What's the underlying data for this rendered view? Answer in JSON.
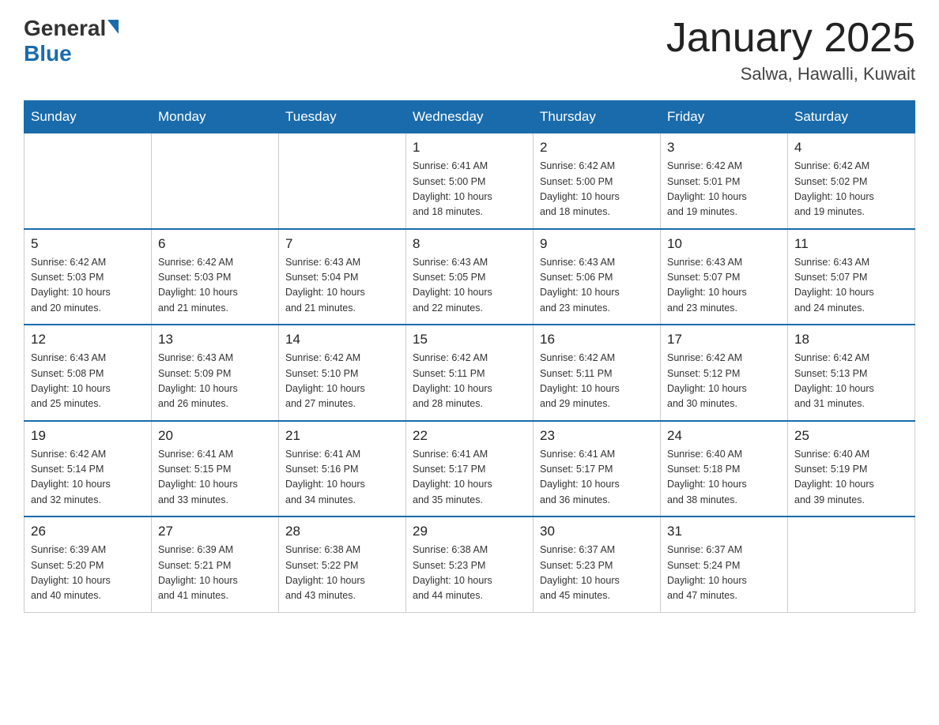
{
  "header": {
    "logo_general": "General",
    "logo_blue": "Blue",
    "title": "January 2025",
    "location": "Salwa, Hawalli, Kuwait"
  },
  "days_of_week": [
    "Sunday",
    "Monday",
    "Tuesday",
    "Wednesday",
    "Thursday",
    "Friday",
    "Saturday"
  ],
  "weeks": [
    {
      "days": [
        {
          "num": "",
          "info": ""
        },
        {
          "num": "",
          "info": ""
        },
        {
          "num": "",
          "info": ""
        },
        {
          "num": "1",
          "info": "Sunrise: 6:41 AM\nSunset: 5:00 PM\nDaylight: 10 hours\nand 18 minutes."
        },
        {
          "num": "2",
          "info": "Sunrise: 6:42 AM\nSunset: 5:00 PM\nDaylight: 10 hours\nand 18 minutes."
        },
        {
          "num": "3",
          "info": "Sunrise: 6:42 AM\nSunset: 5:01 PM\nDaylight: 10 hours\nand 19 minutes."
        },
        {
          "num": "4",
          "info": "Sunrise: 6:42 AM\nSunset: 5:02 PM\nDaylight: 10 hours\nand 19 minutes."
        }
      ]
    },
    {
      "days": [
        {
          "num": "5",
          "info": "Sunrise: 6:42 AM\nSunset: 5:03 PM\nDaylight: 10 hours\nand 20 minutes."
        },
        {
          "num": "6",
          "info": "Sunrise: 6:42 AM\nSunset: 5:03 PM\nDaylight: 10 hours\nand 21 minutes."
        },
        {
          "num": "7",
          "info": "Sunrise: 6:43 AM\nSunset: 5:04 PM\nDaylight: 10 hours\nand 21 minutes."
        },
        {
          "num": "8",
          "info": "Sunrise: 6:43 AM\nSunset: 5:05 PM\nDaylight: 10 hours\nand 22 minutes."
        },
        {
          "num": "9",
          "info": "Sunrise: 6:43 AM\nSunset: 5:06 PM\nDaylight: 10 hours\nand 23 minutes."
        },
        {
          "num": "10",
          "info": "Sunrise: 6:43 AM\nSunset: 5:07 PM\nDaylight: 10 hours\nand 23 minutes."
        },
        {
          "num": "11",
          "info": "Sunrise: 6:43 AM\nSunset: 5:07 PM\nDaylight: 10 hours\nand 24 minutes."
        }
      ]
    },
    {
      "days": [
        {
          "num": "12",
          "info": "Sunrise: 6:43 AM\nSunset: 5:08 PM\nDaylight: 10 hours\nand 25 minutes."
        },
        {
          "num": "13",
          "info": "Sunrise: 6:43 AM\nSunset: 5:09 PM\nDaylight: 10 hours\nand 26 minutes."
        },
        {
          "num": "14",
          "info": "Sunrise: 6:42 AM\nSunset: 5:10 PM\nDaylight: 10 hours\nand 27 minutes."
        },
        {
          "num": "15",
          "info": "Sunrise: 6:42 AM\nSunset: 5:11 PM\nDaylight: 10 hours\nand 28 minutes."
        },
        {
          "num": "16",
          "info": "Sunrise: 6:42 AM\nSunset: 5:11 PM\nDaylight: 10 hours\nand 29 minutes."
        },
        {
          "num": "17",
          "info": "Sunrise: 6:42 AM\nSunset: 5:12 PM\nDaylight: 10 hours\nand 30 minutes."
        },
        {
          "num": "18",
          "info": "Sunrise: 6:42 AM\nSunset: 5:13 PM\nDaylight: 10 hours\nand 31 minutes."
        }
      ]
    },
    {
      "days": [
        {
          "num": "19",
          "info": "Sunrise: 6:42 AM\nSunset: 5:14 PM\nDaylight: 10 hours\nand 32 minutes."
        },
        {
          "num": "20",
          "info": "Sunrise: 6:41 AM\nSunset: 5:15 PM\nDaylight: 10 hours\nand 33 minutes."
        },
        {
          "num": "21",
          "info": "Sunrise: 6:41 AM\nSunset: 5:16 PM\nDaylight: 10 hours\nand 34 minutes."
        },
        {
          "num": "22",
          "info": "Sunrise: 6:41 AM\nSunset: 5:17 PM\nDaylight: 10 hours\nand 35 minutes."
        },
        {
          "num": "23",
          "info": "Sunrise: 6:41 AM\nSunset: 5:17 PM\nDaylight: 10 hours\nand 36 minutes."
        },
        {
          "num": "24",
          "info": "Sunrise: 6:40 AM\nSunset: 5:18 PM\nDaylight: 10 hours\nand 38 minutes."
        },
        {
          "num": "25",
          "info": "Sunrise: 6:40 AM\nSunset: 5:19 PM\nDaylight: 10 hours\nand 39 minutes."
        }
      ]
    },
    {
      "days": [
        {
          "num": "26",
          "info": "Sunrise: 6:39 AM\nSunset: 5:20 PM\nDaylight: 10 hours\nand 40 minutes."
        },
        {
          "num": "27",
          "info": "Sunrise: 6:39 AM\nSunset: 5:21 PM\nDaylight: 10 hours\nand 41 minutes."
        },
        {
          "num": "28",
          "info": "Sunrise: 6:38 AM\nSunset: 5:22 PM\nDaylight: 10 hours\nand 43 minutes."
        },
        {
          "num": "29",
          "info": "Sunrise: 6:38 AM\nSunset: 5:23 PM\nDaylight: 10 hours\nand 44 minutes."
        },
        {
          "num": "30",
          "info": "Sunrise: 6:37 AM\nSunset: 5:23 PM\nDaylight: 10 hours\nand 45 minutes."
        },
        {
          "num": "31",
          "info": "Sunrise: 6:37 AM\nSunset: 5:24 PM\nDaylight: 10 hours\nand 47 minutes."
        },
        {
          "num": "",
          "info": ""
        }
      ]
    }
  ]
}
